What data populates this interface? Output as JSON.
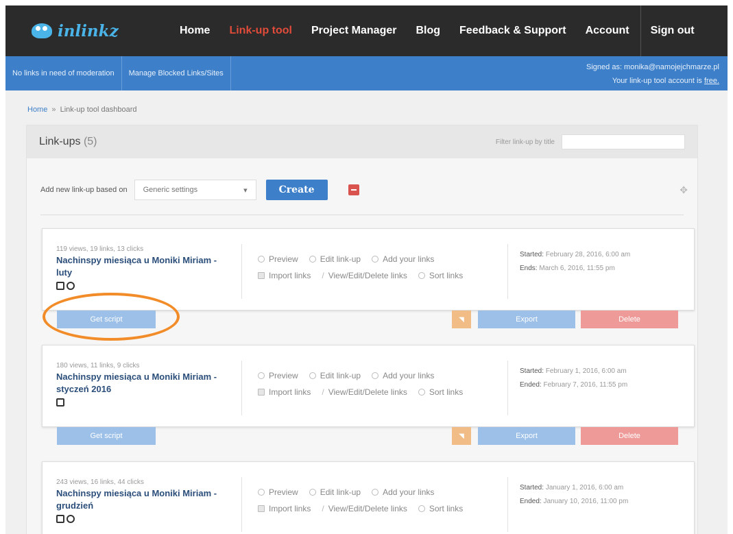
{
  "header": {
    "logo_text": "inlinkz",
    "nav": [
      "Home",
      "Link-up tool",
      "Project Manager",
      "Blog",
      "Feedback & Support",
      "Account",
      "Sign out"
    ]
  },
  "subbar": {
    "items": [
      "No links in need of moderation",
      "Manage Blocked Links/Sites"
    ],
    "signed_as": "Signed as: monika@namojejchmarze.pl",
    "account_prefix": "Your link-up tool account is ",
    "account_type": "free."
  },
  "breadcrumb": {
    "home": "Home",
    "sep": "»",
    "current": "Link-up tool dashboard"
  },
  "panel": {
    "title": "Link-ups",
    "count": "(5)",
    "filter_label": "Filter link-up by title",
    "filter_value": "",
    "add_label": "Add new link-up based on",
    "select_value": "Generic settings",
    "create_label": "Create"
  },
  "actions": {
    "preview": "Preview",
    "edit": "Edit link-up",
    "add_links": "Add your links",
    "import": "Import links",
    "view_edit_delete": "View/Edit/Delete links",
    "sort": "Sort links"
  },
  "buttons": {
    "get_script": "Get script",
    "export": "Export",
    "delete": "Delete"
  },
  "linkups": [
    {
      "stats": "119 views, 19 links, 13 clicks",
      "title": "Nachinspy miesiąca u Moniki Miriam - luty",
      "start_label": "Started:",
      "start": "February 28, 2016, 6:00 am",
      "end_label": "Ends:",
      "end": "March 6, 2016, 11:55 pm"
    },
    {
      "stats": "180 views, 11 links, 9 clicks",
      "title": "Nachinspy miesiąca u Moniki Miriam - styczeń 2016",
      "start_label": "Started:",
      "start": "February 1, 2016, 6:00 am",
      "end_label": "Ended:",
      "end": "February 7, 2016, 11:55 pm"
    },
    {
      "stats": "243 views, 16 links, 44 clicks",
      "title": "Nachinspy miesiąca u Moniki Miriam - grudzień",
      "start_label": "Started:",
      "start": "January 1, 2016, 6:00 am",
      "end_label": "Ended:",
      "end": "January 10, 2016, 11:00 pm"
    }
  ],
  "colors": {
    "nav_active": "#e04b3a",
    "subbar": "#3d7fc9",
    "highlight": "#f28c28"
  }
}
